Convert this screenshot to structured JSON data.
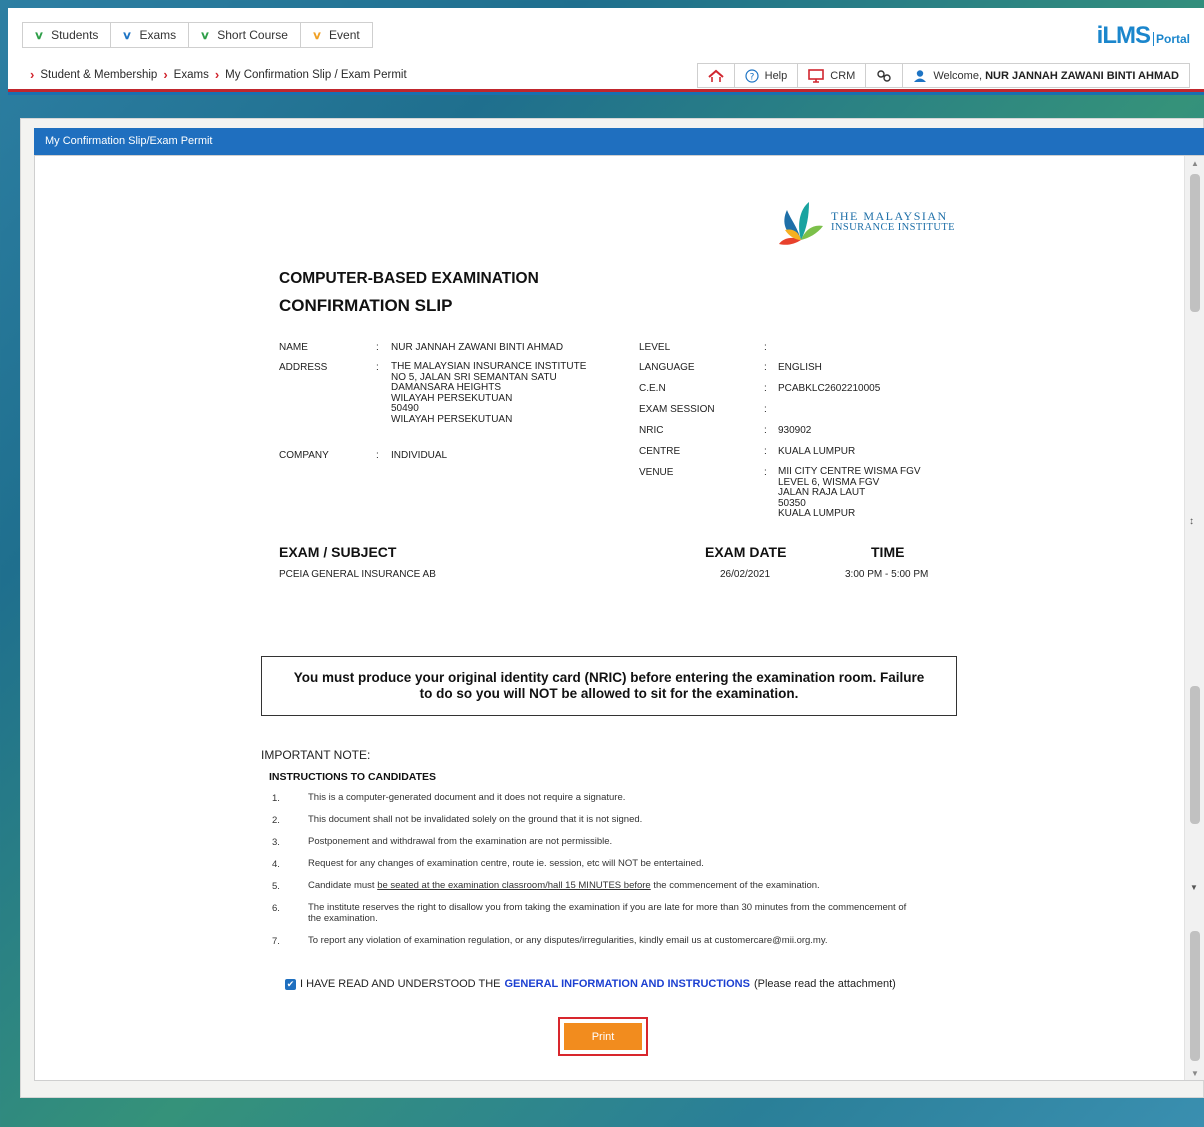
{
  "menu": [
    {
      "label": "Students",
      "chev": "green"
    },
    {
      "label": "Exams",
      "chev": "blue"
    },
    {
      "label": "Short Course",
      "chev": "green"
    },
    {
      "label": "Event",
      "chev": "orange"
    }
  ],
  "breadcrumb": [
    "Student & Membership",
    "Exams",
    "My Confirmation Slip / Exam Permit"
  ],
  "logo": {
    "brand": "iLMS",
    "portal": "Portal"
  },
  "toolbar": {
    "help": "Help",
    "crm": "CRM",
    "welcome_prefix": "Welcome,",
    "user": "NUR JANNAH ZAWANI BINTI AHMAD"
  },
  "panel": {
    "title": "My Confirmation Slip/Exam Permit"
  },
  "institute": {
    "line1": "THE MALAYSIAN",
    "line2": "INSURANCE INSTITUTE"
  },
  "doc": {
    "title1": "COMPUTER-BASED EXAMINATION",
    "title2": "CONFIRMATION SLIP",
    "left": {
      "name_label": "NAME",
      "name": "NUR JANNAH ZAWANI BINTI AHMAD",
      "address_label": "ADDRESS",
      "address": "THE MALAYSIAN INSURANCE INSTITUTE\nNO 5, JALAN SRI SEMANTAN SATU\nDAMANSARA HEIGHTS\nWILAYAH PERSEKUTUAN\n50490\nWILAYAH PERSEKUTUAN",
      "company_label": "COMPANY",
      "company": "INDIVIDUAL"
    },
    "right": {
      "level_label": "LEVEL",
      "level": "",
      "language_label": "LANGUAGE",
      "language": "ENGLISH",
      "cen_label": "C.E.N",
      "cen": "PCABKLC2602210005",
      "session_label": "EXAM SESSION",
      "session": "",
      "nric_label": "NRIC",
      "nric": "930902",
      "centre_label": "CENTRE",
      "centre": "KUALA LUMPUR",
      "venue_label": "VENUE",
      "venue": "MII CITY CENTRE WISMA FGV\nLEVEL 6, WISMA FGV\nJALAN RAJA LAUT\n50350\nKUALA LUMPUR"
    },
    "colon": ":",
    "exam_header": {
      "subject": "EXAM / SUBJECT",
      "date": "EXAM DATE",
      "time": "TIME"
    },
    "exam_row": {
      "subject": "PCEIA GENERAL INSURANCE AB",
      "date": "26/02/2021",
      "time": "3:00 PM - 5:00 PM"
    },
    "notice": "You must produce your original identity card (NRIC) before entering the examination room. Failure to do so you will NOT be allowed to sit for the examination.",
    "important_note": "IMPORTANT NOTE:",
    "instructions_heading": "INSTRUCTIONS TO CANDIDATES",
    "instructions": [
      {
        "num": "1.",
        "text": "This is a computer-generated document and it does not require a signature."
      },
      {
        "num": "2.",
        "text": "This document shall not be invalidated solely on the ground that it is not signed."
      },
      {
        "num": "3.",
        "text": "Postponement and withdrawal from the examination are not permissible."
      },
      {
        "num": "4.",
        "text": "Request for any changes of examination centre, route ie. session, etc will NOT be entertained."
      },
      {
        "num": "5.",
        "text_pre": "Candidate must ",
        "text_u": "be seated at the examination classroom/hall 15 MINUTES before",
        "text_post": " the commencement of the examination."
      },
      {
        "num": "6.",
        "text": "The institute reserves the right to disallow you from taking the examination if you are late for more than 30 minutes from the commencement of the examination."
      },
      {
        "num": "7.",
        "text": "To report any violation of examination regulation, or any disputes/irregularities, kindly email us at customercare@mii.org.my."
      }
    ],
    "agree_pre": "I HAVE READ AND UNDERSTOOD THE",
    "agree_link": "GENERAL INFORMATION AND INSTRUCTIONS",
    "agree_post": "(Please read the attachment)",
    "print": "Print"
  }
}
